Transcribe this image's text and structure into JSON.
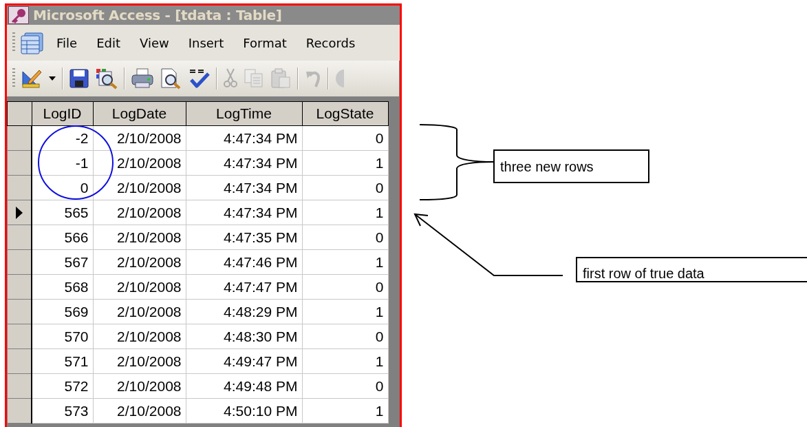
{
  "window": {
    "title": "Microsoft Access - [tdata : Table]"
  },
  "menu": [
    {
      "label": "File"
    },
    {
      "label": "Edit"
    },
    {
      "label": "View"
    },
    {
      "label": "Insert"
    },
    {
      "label": "Format"
    },
    {
      "label": "Records"
    }
  ],
  "toolbar": [
    {
      "kind": "design",
      "disabled": false
    },
    {
      "kind": "dropdown",
      "disabled": false
    },
    {
      "kind": "separator"
    },
    {
      "kind": "save",
      "disabled": false
    },
    {
      "kind": "search",
      "disabled": false
    },
    {
      "kind": "separator"
    },
    {
      "kind": "print",
      "disabled": false
    },
    {
      "kind": "preview",
      "disabled": false
    },
    {
      "kind": "spelling",
      "disabled": false
    },
    {
      "kind": "separator"
    },
    {
      "kind": "cut",
      "disabled": true
    },
    {
      "kind": "copy",
      "disabled": true
    },
    {
      "kind": "paste",
      "disabled": true
    },
    {
      "kind": "separator"
    },
    {
      "kind": "undo",
      "disabled": true
    },
    {
      "kind": "separator"
    },
    {
      "kind": "round"
    }
  ],
  "table": {
    "columns": [
      "LogID",
      "LogDate",
      "LogTime",
      "LogState"
    ],
    "rows": [
      {
        "cells": [
          "-2",
          "2/10/2008",
          "4:47:34 PM",
          "0"
        ],
        "selected": false
      },
      {
        "cells": [
          "-1",
          "2/10/2008",
          "4:47:34 PM",
          "1"
        ],
        "selected": false
      },
      {
        "cells": [
          "0",
          "2/10/2008",
          "4:47:34 PM",
          "0"
        ],
        "selected": false
      },
      {
        "cells": [
          "565",
          "2/10/2008",
          "4:47:34 PM",
          "1"
        ],
        "selected": true
      },
      {
        "cells": [
          "566",
          "2/10/2008",
          "4:47:35 PM",
          "0"
        ],
        "selected": false
      },
      {
        "cells": [
          "567",
          "2/10/2008",
          "4:47:46 PM",
          "1"
        ],
        "selected": false
      },
      {
        "cells": [
          "568",
          "2/10/2008",
          "4:47:47 PM",
          "0"
        ],
        "selected": false
      },
      {
        "cells": [
          "569",
          "2/10/2008",
          "4:48:29 PM",
          "1"
        ],
        "selected": false
      },
      {
        "cells": [
          "570",
          "2/10/2008",
          "4:48:30 PM",
          "0"
        ],
        "selected": false
      },
      {
        "cells": [
          "571",
          "2/10/2008",
          "4:49:47 PM",
          "1"
        ],
        "selected": false
      },
      {
        "cells": [
          "572",
          "2/10/2008",
          "4:49:48 PM",
          "0"
        ],
        "selected": false
      },
      {
        "cells": [
          "573",
          "2/10/2008",
          "4:50:10 PM",
          "1"
        ],
        "selected": false
      }
    ]
  },
  "annotations": [
    {
      "kind": "ellipse"
    },
    {
      "kind": "brace",
      "text": "three new rows"
    },
    {
      "kind": "arrow",
      "text": "first row of true data"
    }
  ]
}
